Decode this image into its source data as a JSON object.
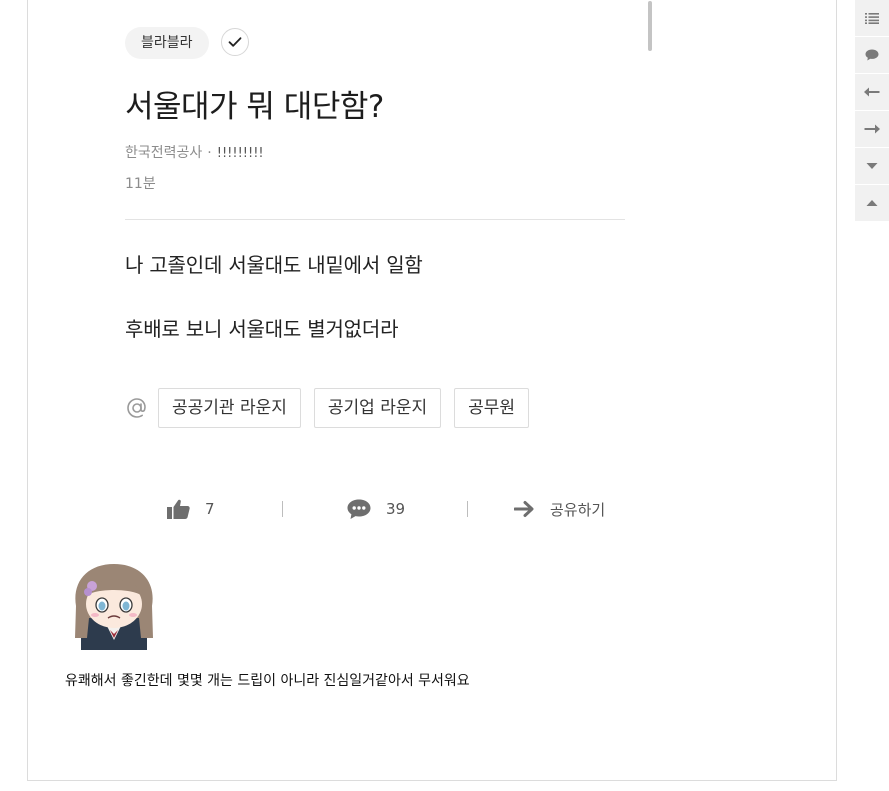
{
  "post": {
    "category_chip": "블라블라",
    "title": "서울대가 뭐 대단함?",
    "company": "한국전력공사",
    "separator": "·",
    "nickname": "!!!!!!!!!",
    "time_ago": "11분",
    "body_lines": [
      "나 고졸인데 서울대도 내밑에서 일함",
      "후배로 보니 서울대도 별거없더라"
    ],
    "tags": [
      "공공기관 라운지",
      "공기업 라운지",
      "공무원"
    ]
  },
  "actions": {
    "like_count": "7",
    "comment_count": "39",
    "share_label": "공유하기"
  },
  "comment": {
    "text": "유쾌해서 좋긴한데 몇몇 개는 드립이 아니라 진심일거같아서 무서워요"
  },
  "rail": {
    "icons": [
      "list-icon",
      "comment-bubble-icon",
      "arrow-left-icon",
      "arrow-right-icon",
      "caret-down-icon",
      "caret-up-icon"
    ]
  },
  "colors": {
    "icon_gray": "#6e6e6e",
    "text_muted": "#8c8c8c",
    "chip_bg": "#f3f3f3"
  }
}
